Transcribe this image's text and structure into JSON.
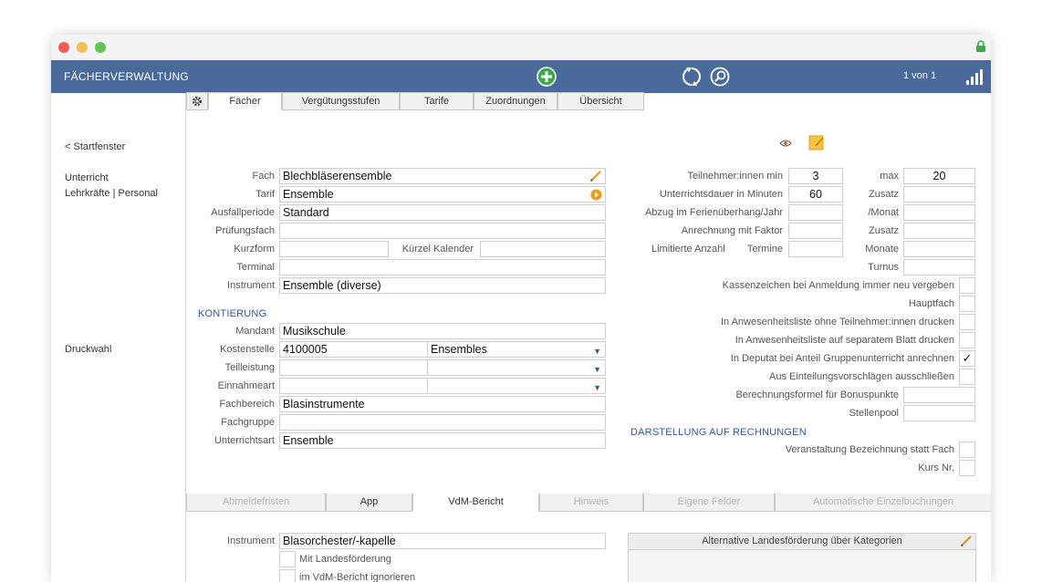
{
  "header": {
    "title": "FÄCHERVERWALTUNG",
    "pager": "1 von 1"
  },
  "sidebar": {
    "back": "< Startfenster",
    "unterricht": "Unterricht",
    "lehrkraefte": "Lehrkräfte | Personal",
    "druckwahl": "Druckwahl"
  },
  "tabs": [
    "Fächer",
    "Vergütungsstufen",
    "Tarife",
    "Zuordnungen",
    "Übersicht"
  ],
  "left": {
    "fach_label": "Fach",
    "fach": "Blechbläserensemble",
    "tarif_label": "Tarif",
    "tarif": "Ensemble",
    "ausfall_label": "Ausfallperiode",
    "ausfall": "Standard",
    "pruef_label": "Prüfungsfach",
    "pruef": "",
    "kurz_label": "Kurzform",
    "kurz": "",
    "kuerzel_label": "Kürzel Kalender",
    "kuerzel": "",
    "terminal_label": "Terminal",
    "terminal": "",
    "instrument_label": "Instrument",
    "instrument": "Ensemble (diverse)"
  },
  "kontierung": {
    "heading": "KONTIERUNG",
    "mandant_label": "Mandant",
    "mandant": "Musikschule",
    "kosten_label": "Kostenstelle",
    "kosten": "4100005",
    "kosten2": "Ensembles",
    "teil_label": "Teilleistung",
    "teil": "",
    "teil2": "",
    "einnahme_label": "Einnahmeart",
    "einnahme": "",
    "einnahme2": "",
    "fachbereich_label": "Fachbereich",
    "fachbereich": "Blasinstrumente",
    "fachgruppe_label": "Fachgruppe",
    "fachgruppe": "",
    "uart_label": "Unterrichtsart",
    "uart": "Ensemble"
  },
  "right": {
    "tn_min_label": "Teilnehmer:innen min",
    "tn_min": "3",
    "max_label": "max",
    "max": "20",
    "dauer_label": "Unterrichtsdauer in Minuten",
    "dauer": "60",
    "zusatz_label": "Zusatz",
    "zusatz": "",
    "abzug_label": "Abzug im Ferienüberhang/Jahr",
    "abzug": "",
    "monat_label": "/Monat",
    "monat": "",
    "faktor_label": "Anrechnung mit Faktor",
    "faktor": "",
    "zusatz2_label": "Zusatz",
    "zusatz2": "",
    "limit_label": "Limitierte Anzahl",
    "termine_label": "Termine",
    "termine": "",
    "monate_label": "Monate",
    "monate": "",
    "turnus_label": "Turnus",
    "turnus": "",
    "cb1": "Kassenzeichen bei Anmeldung immer neu vergeben",
    "cb2": "Hauptfach",
    "cb3": "In Anwesenheitsliste ohne Teilnehmer:innen drucken",
    "cb4": "In Anwesenheitsliste auf separatem Blatt drucken",
    "cb5": "In Deputat bei Anteil Gruppenunterricht anrechnen",
    "cb5_mark": "✓",
    "cb6": "Aus Einteilungsvorschlägen ausschließen",
    "formel_label": "Berechnungsformel für Bonuspunkte",
    "formel": "",
    "stellen_label": "Stellenpool",
    "stellen": "",
    "darstellung_heading": "DARSTELLUNG AUF RECHNUNGEN",
    "cb7": "Veranstaltung Bezeichnung statt Fach",
    "cb8": "Kurs Nr."
  },
  "bottom_tabs": [
    "Abmeldefristen",
    "App",
    "VdM-Bericht",
    "Hinweis",
    "Eigene Felder",
    "Automatische Einzelbuchungen"
  ],
  "vdm": {
    "instrument_label": "Instrument",
    "instrument": "Blasorchester/-kapelle",
    "landes": "Mit Landesförderung",
    "ignorieren": "im VdM-Bericht ignorieren",
    "alt_title": "Alternative Landesförderung über Kategorien"
  },
  "colors": {
    "header_bg": "#4a6a9b",
    "section_blue": "#2d5a9a",
    "arrow_red": "#e0432c",
    "add_green": "#3fa84a"
  }
}
